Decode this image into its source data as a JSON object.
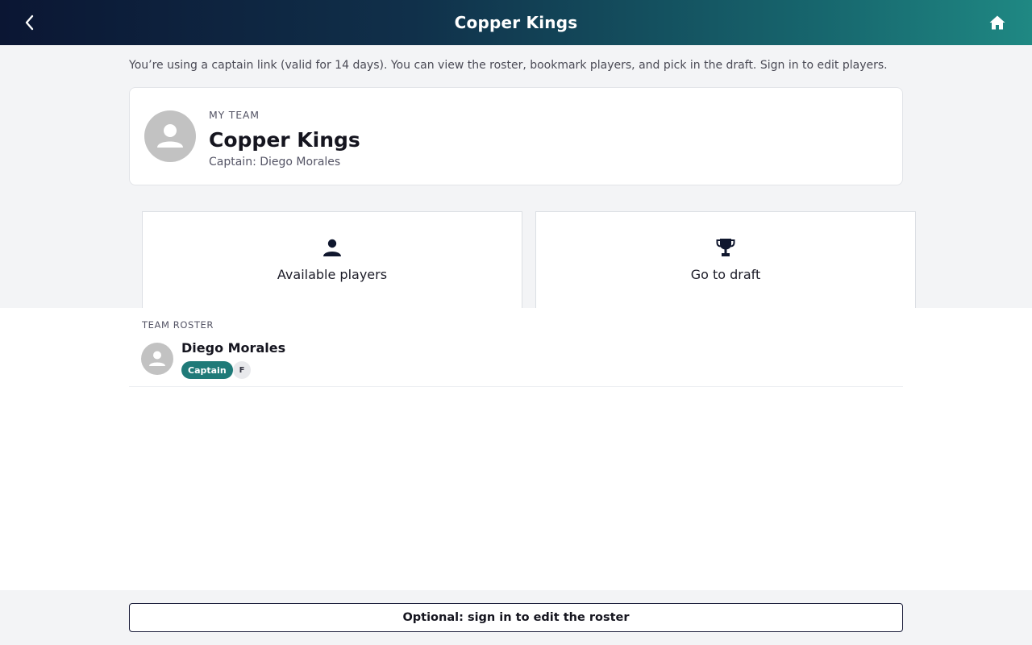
{
  "header": {
    "title": "Copper Kings",
    "back_icon": "chevron-left-icon",
    "home_icon": "home-icon"
  },
  "notice": "You’re using a captain link (valid for 14 days). You can view the roster, bookmark players, and pick in the draft. Sign in to edit players.",
  "team": {
    "eyebrow": "MY TEAM",
    "name": "Copper Kings",
    "captain": "Captain: Diego Morales",
    "avatar_icon": "person-icon"
  },
  "actions": [
    {
      "label": "Available players",
      "icon": "person-icon"
    },
    {
      "label": "Go to draft",
      "icon": "trophy-icon"
    }
  ],
  "roster": {
    "heading": "TEAM ROSTER",
    "players": [
      {
        "name": "Diego Morales",
        "role_badge": "Captain",
        "position": "F"
      }
    ]
  },
  "footer": {
    "signin_label": "Optional: sign in to edit the roster"
  },
  "colors": {
    "header_gradient_start": "#0b1633",
    "header_gradient_end": "#1f8883",
    "captain_badge": "#1f7a78",
    "page_gray": "#f3f4f6"
  }
}
